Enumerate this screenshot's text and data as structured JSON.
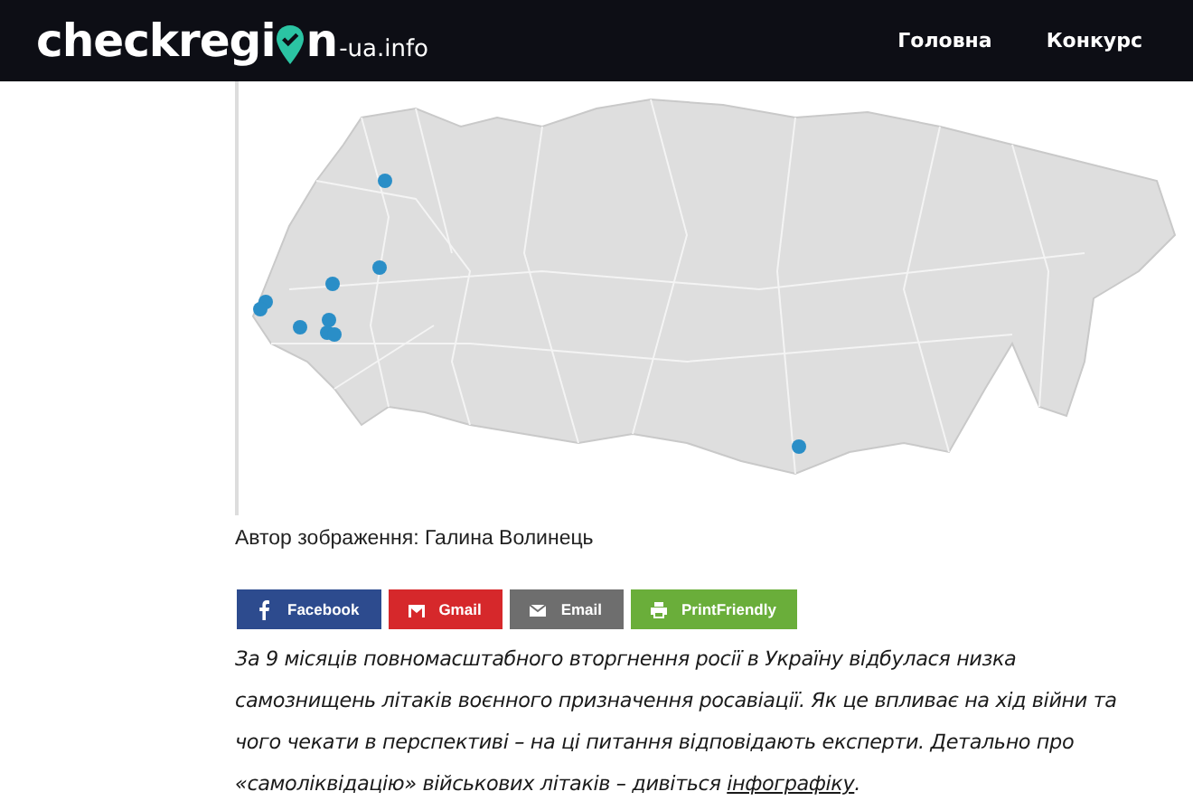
{
  "header": {
    "logo": {
      "start": "checkregi",
      "end": "n",
      "suffix": "-ua.info"
    },
    "nav": [
      {
        "label": "Головна"
      },
      {
        "label": "Конкурс"
      }
    ]
  },
  "article": {
    "caption": "Автор зображення: Галина Волинець",
    "share_buttons": [
      {
        "kind": "facebook",
        "label": "Facebook",
        "color": "#2d4b8e"
      },
      {
        "kind": "gmail",
        "label": "Gmail",
        "color": "#d6282b"
      },
      {
        "kind": "email",
        "label": "Email",
        "color": "#6e6e6e"
      },
      {
        "kind": "print",
        "label": "PrintFriendly",
        "color": "#6aae3a"
      }
    ],
    "paragraph": {
      "text": "За 9 місяців повномасштабного вторгнення росії в Україну відбулася низка самознищень літаків воєнного призначення росавіації. Як це впливає на хід війни та чого чекати в перспективі – на ці питання відповідають експерти. Детально про «самоліквідацію» військових літаків – дивіться ",
      "link": "інфографіку",
      "tail": "."
    }
  }
}
